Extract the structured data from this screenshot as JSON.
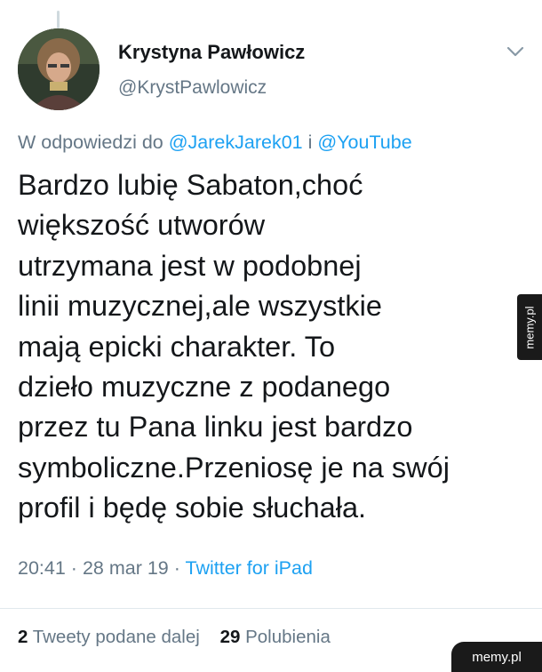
{
  "tweet": {
    "display_name": "Krystyna Pawłowicz",
    "handle": "@KrystPawlowicz",
    "reply_prefix": "W odpowiedzi do",
    "reply_users": [
      "@JarekJarek01",
      "@YouTube"
    ],
    "reply_join": "i",
    "text_lines": [
      "Bardzo lubię  Sabaton,choć",
      "większość utworów",
      "utrzymana jest w podobnej",
      "linii muzycznej,ale wszystkie",
      "mają epicki charakter. To",
      "dzieło muzyczne z podanego",
      "przez tu Pana linku jest bardzo",
      "symboliczne.Przeniosę je na swój",
      "profil i będę sobie słuchała."
    ],
    "time": "20:41",
    "date": "28 mar 19",
    "source": "Twitter for iPad",
    "separator": "·"
  },
  "stats": {
    "retweets_count": "2",
    "retweets_label": "Tweety podane dalej",
    "likes_count": "29",
    "likes_label": "Polubienia"
  },
  "watermark": {
    "side": "memy.pl",
    "corner": "memy.pl"
  },
  "icons": {
    "menu": "chevron-down-icon"
  },
  "colors": {
    "link": "#1da1f2",
    "secondary": "#657786",
    "primary": "#14171a"
  }
}
